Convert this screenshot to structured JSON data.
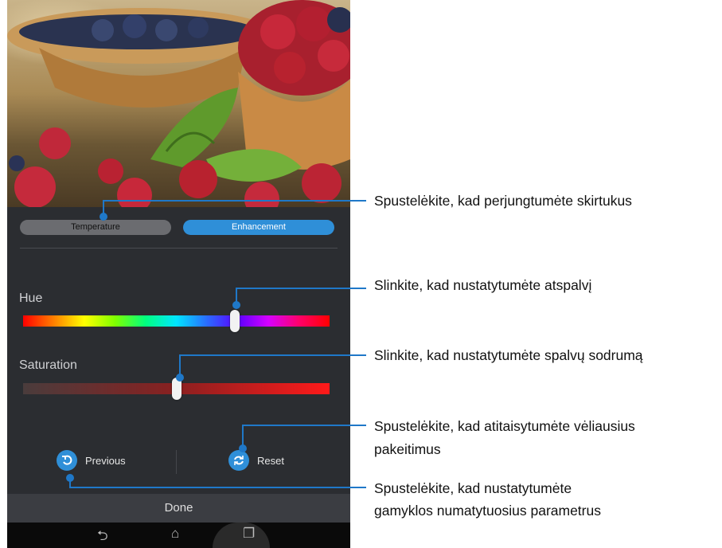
{
  "tabs": {
    "temperature": "Temperature",
    "enhancement": "Enhancement"
  },
  "sliders": {
    "hue": {
      "label": "Hue",
      "value_fraction": 0.69
    },
    "saturation": {
      "label": "Saturation",
      "value_fraction": 0.5
    }
  },
  "actions": {
    "previous": "Previous",
    "reset": "Reset"
  },
  "done_label": "Done",
  "callouts": {
    "tabs": "Spustelėkite, kad perjungtumėte skirtukus",
    "hue": "Slinkite, kad nustatytumėte atspalvį",
    "saturation": "Slinkite, kad nustatytumėte spalvų sodrumą",
    "reset_line1": "Spustelėkite, kad atitaisytumėte vėliausius",
    "reset_line2": "pakeitimus",
    "previous_line1": "Spustelėkite, kad nustatytumėte",
    "previous_line2": "gamyklos numatytuosius parametrus"
  },
  "colors": {
    "accent": "#2f8fd8",
    "panel": "#2b2d31"
  }
}
